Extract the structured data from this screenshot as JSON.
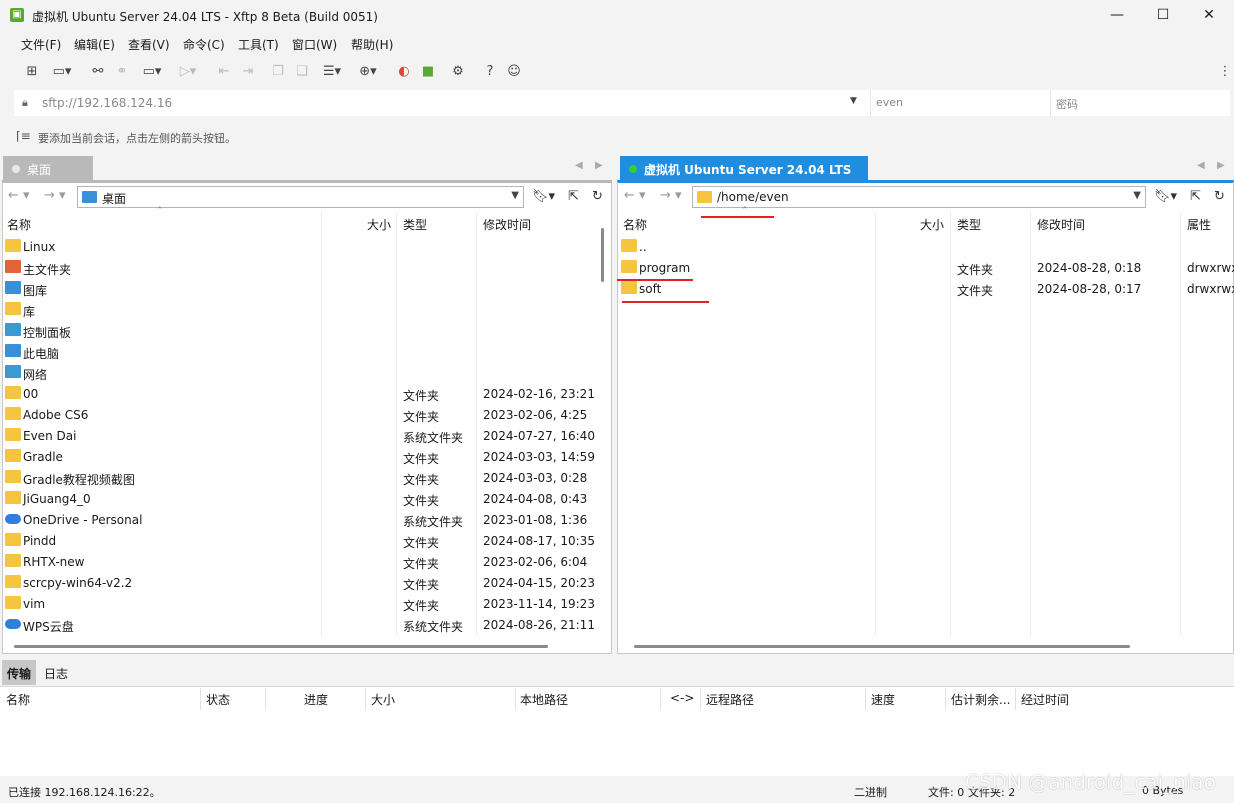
{
  "window": {
    "title": "虚拟机 Ubuntu Server 24.04 LTS - Xftp 8 Beta (Build 0051)",
    "minimize": "—",
    "maximize": "☐",
    "close": "✕"
  },
  "menu": [
    "文件(F)",
    "编辑(E)",
    "查看(V)",
    "命令(C)",
    "工具(T)",
    "窗口(W)",
    "帮助(H)"
  ],
  "address": {
    "value": "sftp://192.168.124.16",
    "user_placeholder": "even",
    "password_placeholder": "密码"
  },
  "hint": "要添加当前会话，点击左侧的箭头按钮。",
  "left_tab": {
    "label": "桌面"
  },
  "right_tab": {
    "label": "虚拟机 Ubuntu Server 24.04 LTS"
  },
  "left_pane": {
    "path": "桌面",
    "columns": [
      "名称",
      "大小",
      "类型",
      "修改时间"
    ],
    "rows": [
      {
        "name": "Linux",
        "type": "",
        "modified": ""
      },
      {
        "name": "主文件夹",
        "type": "",
        "modified": ""
      },
      {
        "name": "图库",
        "type": "",
        "modified": ""
      },
      {
        "name": "库",
        "type": "",
        "modified": ""
      },
      {
        "name": "控制面板",
        "type": "",
        "modified": ""
      },
      {
        "name": "此电脑",
        "type": "",
        "modified": ""
      },
      {
        "name": "网络",
        "type": "",
        "modified": ""
      },
      {
        "name": "00",
        "type": "文件夹",
        "modified": "2024-02-16, 23:21"
      },
      {
        "name": "Adobe CS6",
        "type": "文件夹",
        "modified": "2023-02-06, 4:25"
      },
      {
        "name": "Even Dai",
        "type": "系统文件夹",
        "modified": "2024-07-27, 16:40"
      },
      {
        "name": "Gradle",
        "type": "文件夹",
        "modified": "2024-03-03, 14:59"
      },
      {
        "name": "Gradle教程视频截图",
        "type": "文件夹",
        "modified": "2024-03-03, 0:28"
      },
      {
        "name": "JiGuang4_0",
        "type": "文件夹",
        "modified": "2024-04-08, 0:43"
      },
      {
        "name": "OneDrive - Personal",
        "type": "系统文件夹",
        "modified": "2023-01-08, 1:36"
      },
      {
        "name": "Pindd",
        "type": "文件夹",
        "modified": "2024-08-17, 10:35"
      },
      {
        "name": "RHTX-new",
        "type": "文件夹",
        "modified": "2023-02-06, 6:04"
      },
      {
        "name": "scrcpy-win64-v2.2",
        "type": "文件夹",
        "modified": "2024-04-15, 20:23"
      },
      {
        "name": "vim",
        "type": "文件夹",
        "modified": "2023-11-14, 19:23"
      },
      {
        "name": "WPS云盘",
        "type": "系统文件夹",
        "modified": "2024-08-26, 21:11"
      }
    ]
  },
  "right_pane": {
    "path": "/home/even",
    "columns": [
      "名称",
      "大小",
      "类型",
      "修改时间",
      "属性"
    ],
    "rows": [
      {
        "name": "..",
        "type": "",
        "modified": "",
        "attr": ""
      },
      {
        "name": "program",
        "type": "文件夹",
        "modified": "2024-08-28, 0:18",
        "attr": "drwxrwx"
      },
      {
        "name": "soft",
        "type": "文件夹",
        "modified": "2024-08-28, 0:17",
        "attr": "drwxrwx"
      }
    ]
  },
  "bottom_tabs": {
    "transfer": "传输",
    "log": "日志"
  },
  "transfer_columns": [
    "名称",
    "状态",
    "进度",
    "大小",
    "本地路径",
    "<->",
    "远程路径",
    "速度",
    "估计剩余...",
    "经过时间"
  ],
  "status": {
    "connection": "已连接 192.168.124.16:22。",
    "mode": "二进制",
    "files": "文件: 0",
    "folders": "文件夹: 2",
    "bytes": "0 Bytes"
  },
  "watermark": "CSDN @android_cai_niao",
  "colors": {
    "accent": "#1f8de0",
    "folder": "#f5c542",
    "annotation": "#e0202a"
  }
}
